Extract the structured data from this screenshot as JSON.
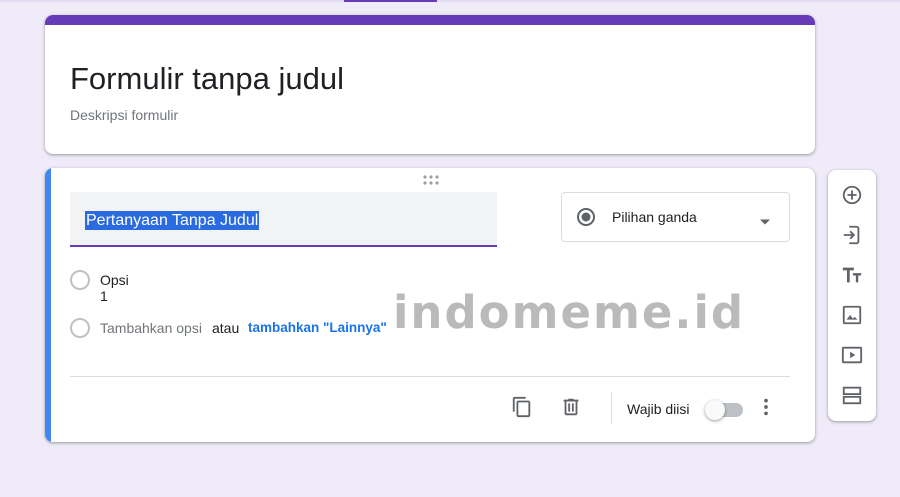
{
  "form": {
    "title": "Formulir tanpa judul",
    "description_placeholder": "Deskripsi formulir"
  },
  "question": {
    "title": "Pertanyaan Tanpa Judul",
    "type": "Pilihan ganda",
    "options": [
      {
        "label": "Opsi 1"
      }
    ],
    "add_option": "Tambahkan opsi",
    "or_text": "atau",
    "add_other": "tambahkan \"Lainnya\"",
    "required_label": "Wajib diisi",
    "required": false
  },
  "toolbar": {
    "items": [
      "add-question-icon",
      "import-questions-icon",
      "add-title-icon",
      "add-image-icon",
      "add-video-icon",
      "add-section-icon"
    ]
  },
  "watermark": "indomeme.id",
  "colors": {
    "theme": "#673ab7",
    "background": "#efebf8",
    "accent": "#4285f4",
    "link": "#1a73e8"
  }
}
